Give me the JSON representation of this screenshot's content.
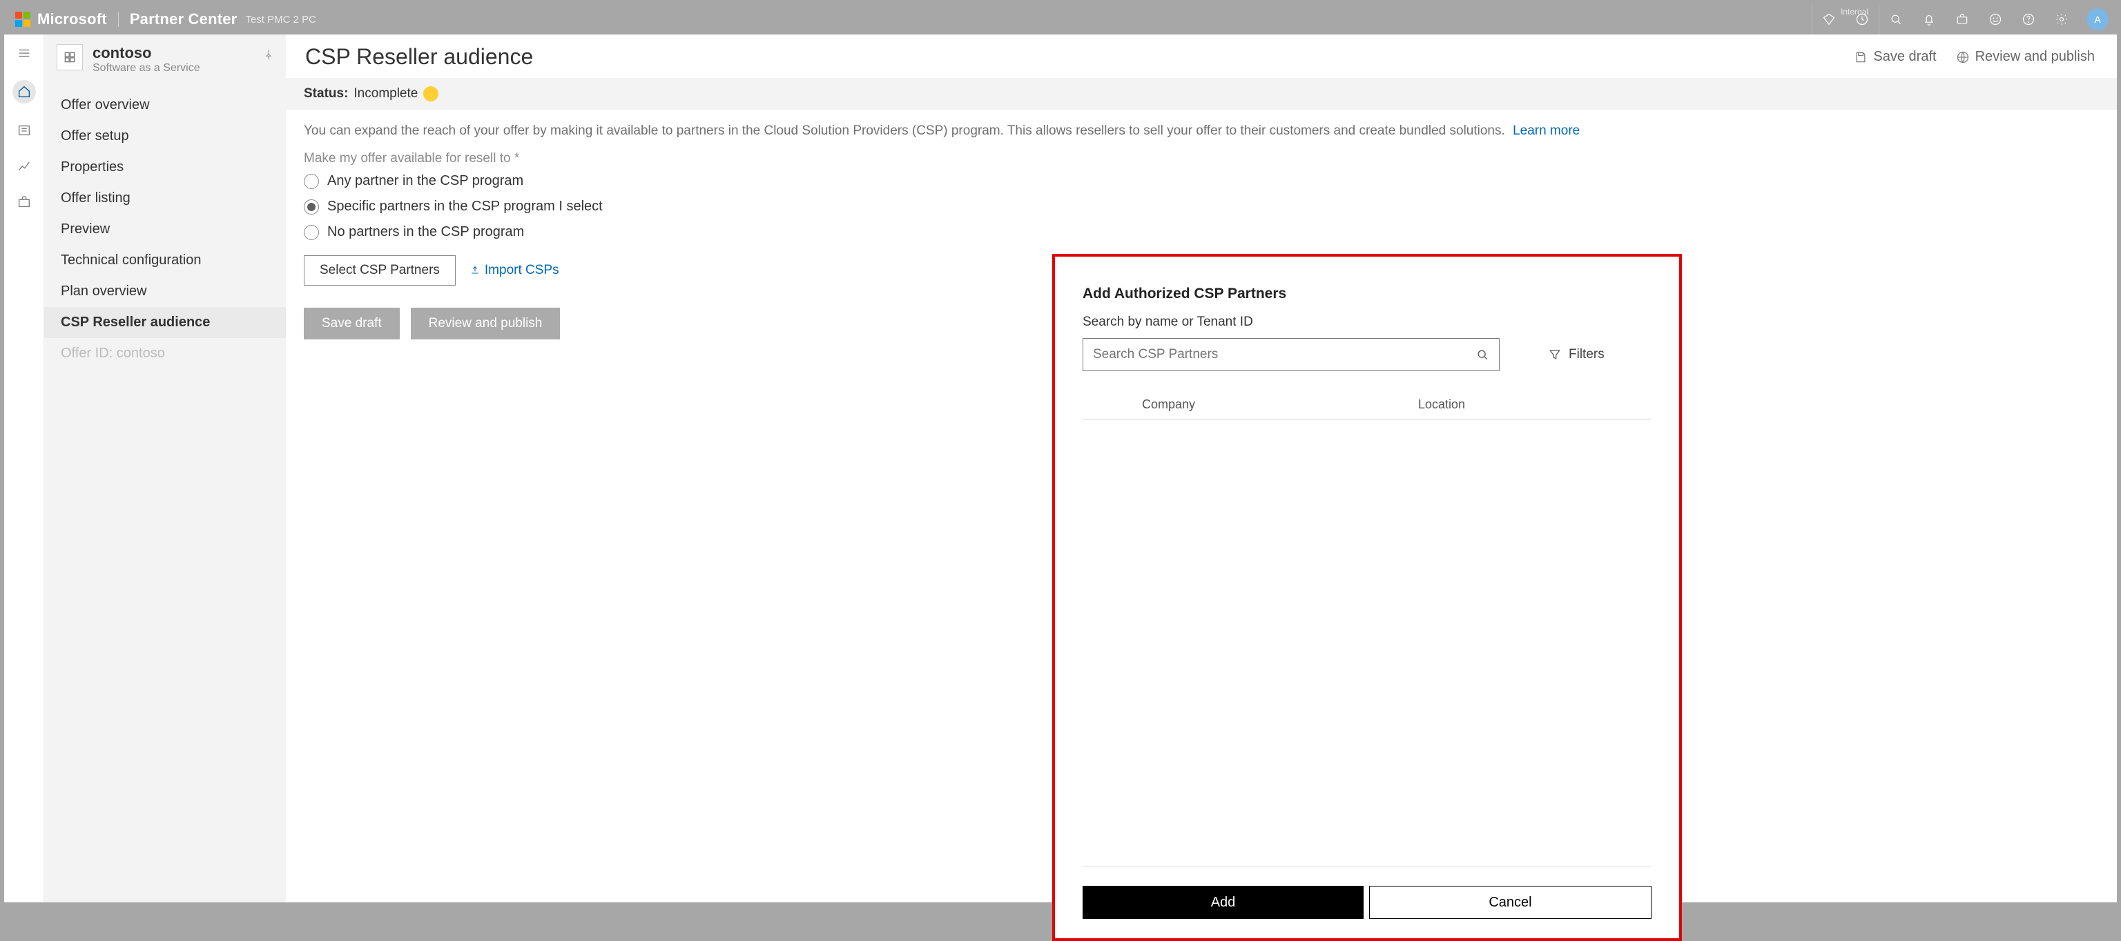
{
  "header": {
    "brand": "Microsoft",
    "app": "Partner Center",
    "env": "Test PMC 2 PC",
    "internal_label": "Internal",
    "avatar_initial": "A"
  },
  "product": {
    "name": "contoso",
    "subtitle": "Software as a Service"
  },
  "sidebar": {
    "items": [
      {
        "label": "Offer overview"
      },
      {
        "label": "Offer setup"
      },
      {
        "label": "Properties"
      },
      {
        "label": "Offer listing"
      },
      {
        "label": "Preview"
      },
      {
        "label": "Technical configuration"
      },
      {
        "label": "Plan overview"
      },
      {
        "label": "CSP Reseller audience"
      },
      {
        "label": "Offer ID: contoso"
      }
    ]
  },
  "page": {
    "title": "CSP Reseller audience",
    "actions": {
      "save_draft": "Save draft",
      "review_publish": "Review and publish"
    },
    "status_key": "Status:",
    "status_value": "Incomplete",
    "description": "You can expand the reach of your offer by making it available to partners in the Cloud Solution Providers (CSP) program. This allows resellers to sell your offer to their customers and create bundled solutions.",
    "learn_more": "Learn more",
    "field_label": "Make my offer available for resell to *",
    "radios": [
      "Any partner in the CSP program",
      "Specific partners in the CSP program I select",
      "No partners in the CSP program"
    ],
    "select_partners_btn": "Select CSP Partners",
    "import_link": "Import CSPs",
    "save_draft_btn": "Save draft",
    "review_publish_btn": "Review and publish"
  },
  "dialog": {
    "title": "Add Authorized CSP Partners",
    "subtitle": "Search by name or Tenant ID",
    "search_placeholder": "Search CSP Partners",
    "filters_label": "Filters",
    "columns": {
      "company": "Company",
      "location": "Location"
    },
    "add_btn": "Add",
    "cancel_btn": "Cancel"
  }
}
